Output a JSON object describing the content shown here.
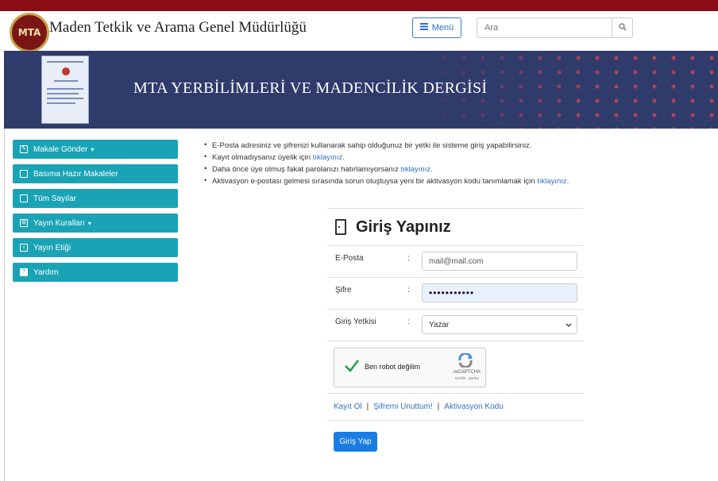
{
  "header": {
    "logo_text": "MTA",
    "site_title": "Maden Tetkik ve Arama Genel Müdürlüğü",
    "menu_label": "Menü",
    "search_placeholder": "Ara"
  },
  "banner": {
    "title": "MTA YERBİLİMLERİ VE MADENCİLİK DERGİSİ"
  },
  "sidebar": {
    "items": [
      {
        "label": "Makale Gönder",
        "icon": "edit-icon",
        "caret": "▾"
      },
      {
        "label": "Basıma Hazır Makaleler",
        "icon": "folder-icon",
        "caret": ""
      },
      {
        "label": "Tüm Sayılar",
        "icon": "archive-icon",
        "caret": ""
      },
      {
        "label": "Yayın Kuralları",
        "icon": "grid-icon",
        "caret": "▾"
      },
      {
        "label": "Yayın Etiği",
        "icon": "info-icon",
        "caret": ""
      },
      {
        "label": "Yardım",
        "icon": "help-icon",
        "caret": ""
      }
    ]
  },
  "notes": [
    {
      "text": "E-Posta adresiniz ve şifrenizi kullanarak sahip olduğunuz bir yetki ile sisteme giriş yapabilirsiniz.",
      "link": ""
    },
    {
      "text": "Kayıt olmadıysanız üyelik için ",
      "link": "tıklayınız."
    },
    {
      "text": "Daha önce üye olmuş fakat parolanızı hatırlamıyorsanız ",
      "link": "tıklayınız."
    },
    {
      "text": "Aktivasyon e-postası gelmesi sırasında sorun oluştuysa yeni bir aktivasyon kodu tanımlamak için ",
      "link": "tıklayınız."
    }
  ],
  "login": {
    "title": "Giriş Yapınız",
    "email_label": "E-Posta",
    "email_placeholder": "mail@mail.com",
    "password_label": "Şifre",
    "password_value": "•••••••••••",
    "role_label": "Giriş Yetkisi",
    "role_value": "Yazar",
    "colon": ":",
    "captcha_text": "Ben robot değilim",
    "captcha_brand": "reCAPTCHA",
    "captcha_privacy": "Gizlilik - Şartlar",
    "link_register": "Kayıt Ol",
    "link_forgot": "Şifremi Unuttum!",
    "link_activation": "Aktivasyon Kodu",
    "separator": "|",
    "submit_label": "Giriş Yap"
  },
  "colors": {
    "topbar": "#8b0d14",
    "banner": "#2f3b6b",
    "sidebar_item": "#1aa3b5",
    "link": "#2f6fc7",
    "primary_button": "#1a7de6"
  }
}
